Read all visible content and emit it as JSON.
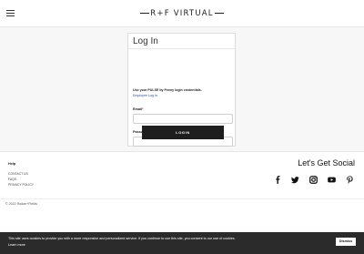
{
  "header": {
    "menu_icon": "hamburger-menu-icon",
    "logo": {
      "left": "R",
      "plus": "+",
      "right": "F",
      "word": "VIRTUAL"
    }
  },
  "login": {
    "title": "Log In",
    "instructions": "Use your PULSE by Peeny login credentials.",
    "employee_link": "Employee Log In",
    "email_label": "Email",
    "password_label": "Password",
    "required_marker": "*",
    "email_value": "",
    "password_value": "",
    "button_label": "LOGIN"
  },
  "footer": {
    "help_heading": "Help",
    "links": [
      "CONTACT US",
      "FAQS",
      "PRIVACY POLICY"
    ],
    "social_heading": "Let's Get Social",
    "social_icons": [
      "facebook-icon",
      "twitter-icon",
      "instagram-icon",
      "youtube-icon",
      "pinterest-icon"
    ],
    "copyright": "© 2022 Rodan+Fields"
  },
  "cookie_banner": {
    "text": "This site uses cookies to provide you with a more responsive and personalized service. If you continue to use this site, you consent to our use of cookies.",
    "learn_more": "Learn more",
    "dismiss_label": "Dismiss"
  },
  "colors": {
    "page_background": "#f7f7f7",
    "button_dark": "#1e1e1e",
    "link_blue": "#2c4f8a",
    "cookie_bar": "#2b2b2b"
  }
}
